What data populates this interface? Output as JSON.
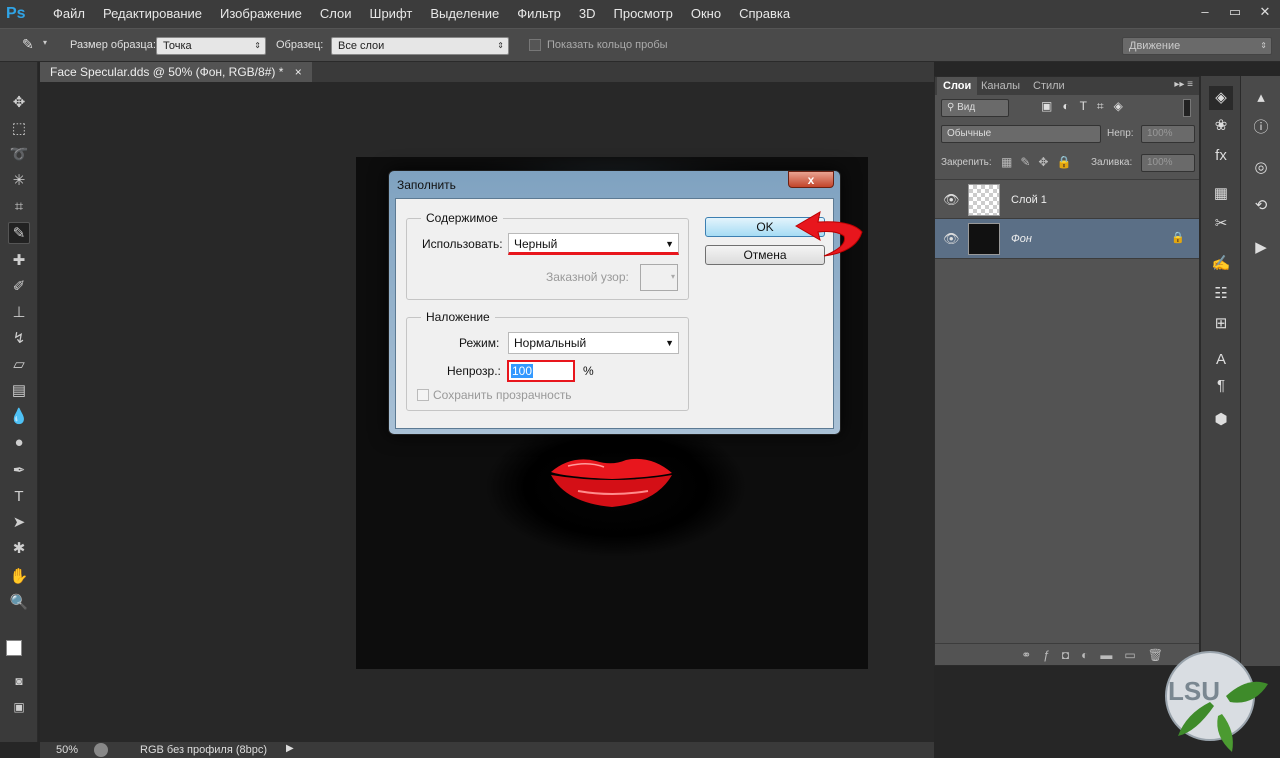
{
  "menubar": {
    "logo": "Ps",
    "items": [
      "Файл",
      "Редактирование",
      "Изображение",
      "Слои",
      "Шрифт",
      "Выделение",
      "Фильтр",
      "3D",
      "Просмотр",
      "Окно",
      "Справка"
    ]
  },
  "window_controls": {
    "minimize": "–",
    "restore": "▭",
    "close": "✕"
  },
  "options": {
    "sample_size_label": "Размер образца:",
    "sample_size_value": "Точка",
    "sample_label": "Образец:",
    "sample_value": "Все слои",
    "show_ring_label": "Показать кольцо пробы",
    "workspace_value": "Движение"
  },
  "document_tab": {
    "title": "Face Specular.dds @ 50% (Фон, RGB/8#) *",
    "close": "×"
  },
  "status": {
    "zoom": "50%",
    "profile": "RGB без профиля (8bpc)"
  },
  "layers_panel": {
    "tabs": [
      "Слои",
      "Каналы",
      "Стили"
    ],
    "filter_label": "Вид",
    "blend_mode": "Обычные",
    "opacity_label": "Непр:",
    "opacity_value": "100%",
    "lock_label": "Закрепить:",
    "fill_label": "Заливка:",
    "fill_value": "100%",
    "layers": [
      {
        "name": "Слой 1",
        "selected": false
      },
      {
        "name": "Фон",
        "selected": true
      }
    ]
  },
  "dialog": {
    "title": "Заполнить",
    "close": "x",
    "contents_title": "Содержимое",
    "use_label": "Использовать:",
    "use_value": "Черный",
    "custom_pattern_label": "Заказной узор:",
    "blending_title": "Наложение",
    "mode_label": "Режим:",
    "mode_value": "Нормальный",
    "opacity_label": "Непрозр.:",
    "opacity_value": "100",
    "opacity_unit": "%",
    "preserve_label": "Сохранить прозрачность",
    "ok": "OK",
    "cancel": "Отмена"
  },
  "colors": {
    "accent_red": "#e8161d",
    "ps_blue": "#30a4e6",
    "selected_layer": "#5b6f86"
  }
}
